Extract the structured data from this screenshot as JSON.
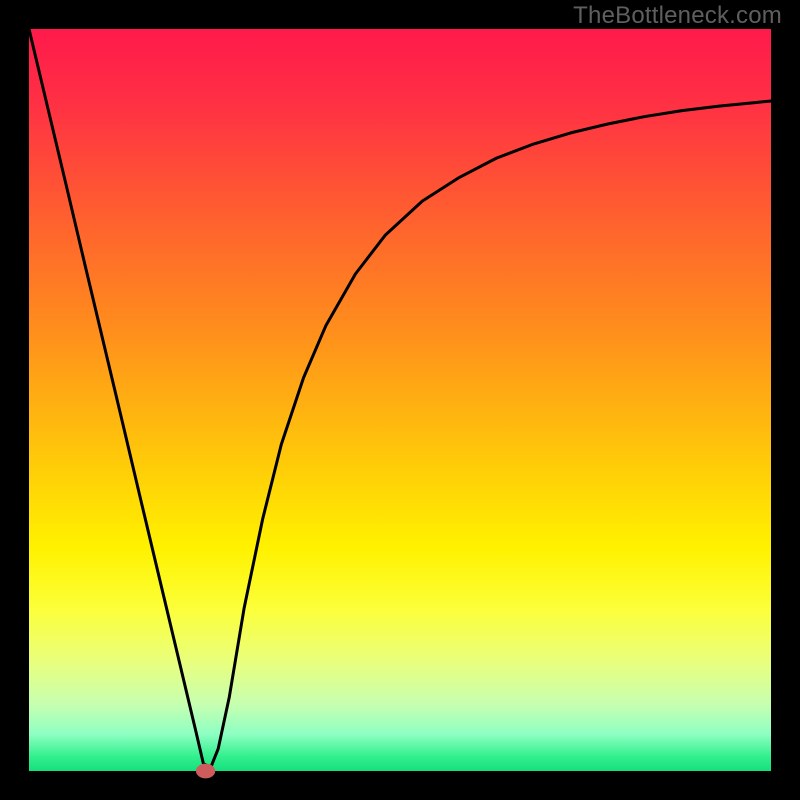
{
  "watermark": "TheBottleneck.com",
  "chart_data": {
    "type": "line",
    "title": "",
    "xlabel": "",
    "ylabel": "",
    "xlim": [
      0,
      100
    ],
    "ylim": [
      0,
      100
    ],
    "grid": false,
    "legend": false,
    "background": {
      "type": "vertical-gradient",
      "stops": [
        {
          "pos": 0.0,
          "color": "#ff1a4b"
        },
        {
          "pos": 0.1,
          "color": "#ff3044"
        },
        {
          "pos": 0.2,
          "color": "#ff4f36"
        },
        {
          "pos": 0.3,
          "color": "#ff6e29"
        },
        {
          "pos": 0.4,
          "color": "#ff8c1d"
        },
        {
          "pos": 0.5,
          "color": "#ffae12"
        },
        {
          "pos": 0.6,
          "color": "#ffd007"
        },
        {
          "pos": 0.7,
          "color": "#fff200"
        },
        {
          "pos": 0.78,
          "color": "#fcff38"
        },
        {
          "pos": 0.85,
          "color": "#eaff7a"
        },
        {
          "pos": 0.91,
          "color": "#c7ffb0"
        },
        {
          "pos": 0.95,
          "color": "#8effc3"
        },
        {
          "pos": 0.98,
          "color": "#34f08e"
        },
        {
          "pos": 1.0,
          "color": "#14e07c"
        }
      ]
    },
    "series": [
      {
        "name": "bottleneck-curve",
        "x": [
          0.0,
          2.5,
          5.0,
          7.5,
          10.0,
          12.5,
          15.0,
          17.5,
          20.0,
          22.5,
          23.5,
          24.5,
          25.5,
          27.0,
          29.0,
          31.5,
          34.0,
          37.0,
          40.0,
          44.0,
          48.0,
          53.0,
          58.0,
          63.0,
          68.0,
          73.0,
          78.0,
          83.0,
          88.0,
          93.0,
          98.0,
          100.0
        ],
        "values": [
          100.0,
          89.5,
          79.0,
          68.4,
          57.9,
          47.4,
          36.8,
          26.3,
          15.8,
          5.3,
          1.0,
          0.5,
          3.0,
          10.0,
          22.0,
          34.0,
          44.0,
          53.0,
          60.0,
          67.0,
          72.2,
          76.8,
          80.0,
          82.6,
          84.5,
          86.0,
          87.2,
          88.2,
          89.0,
          89.6,
          90.1,
          90.3
        ]
      }
    ],
    "marker": {
      "x": 23.8,
      "y": 0.0,
      "rx": 1.3,
      "ry": 1.0,
      "color": "#cd5c5c"
    },
    "frame": {
      "thickness_px": 29,
      "color": "#000000"
    }
  }
}
